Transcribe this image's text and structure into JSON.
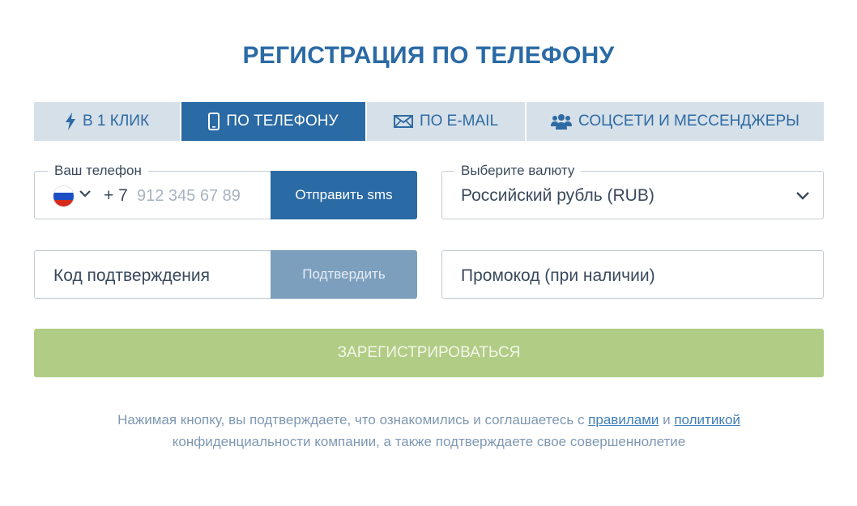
{
  "header": {
    "title": "РЕГИСТРАЦИЯ ПО ТЕЛЕФОНУ"
  },
  "tabs": [
    {
      "label": "В 1 КЛИК",
      "icon": "lightning-icon",
      "active": false
    },
    {
      "label": "ПО ТЕЛЕФОНУ",
      "icon": "phone-icon",
      "active": true
    },
    {
      "label": "ПО E-MAIL",
      "icon": "envelope-icon",
      "active": false
    },
    {
      "label": "СОЦСЕТИ И МЕССЕНДЖЕРЫ",
      "icon": "users-icon",
      "active": false
    }
  ],
  "phone": {
    "legend": "Ваш телефон",
    "country_icon": "russia-flag-icon",
    "prefix": "+ 7",
    "placeholder": "912 345 67 89",
    "value": "",
    "send_button": "Отправить sms"
  },
  "currency": {
    "legend": "Выберите валюту",
    "selected": "Российский рубль (RUB)"
  },
  "code": {
    "label": "Код подтверждения",
    "confirm_button": "Подтвердить"
  },
  "promo": {
    "label": "Промокод (при наличии)"
  },
  "register_button": "ЗАРЕГИСТРИРОВАТЬСЯ",
  "terms": {
    "before": "Нажимая кнопку, вы подтверждаете, что ознакомились и соглашаетесь с ",
    "rules_link": "правилами",
    "and": " и ",
    "policy_link": "политикой",
    "after": "конфиденциальности компании, а также подтверждаете свое совершеннолетие"
  },
  "colors": {
    "accent": "#2a6aa5",
    "tab_inactive": "#d6e0e9",
    "register_button": "#b1cc84",
    "confirm_disabled": "#7d9fbe"
  }
}
